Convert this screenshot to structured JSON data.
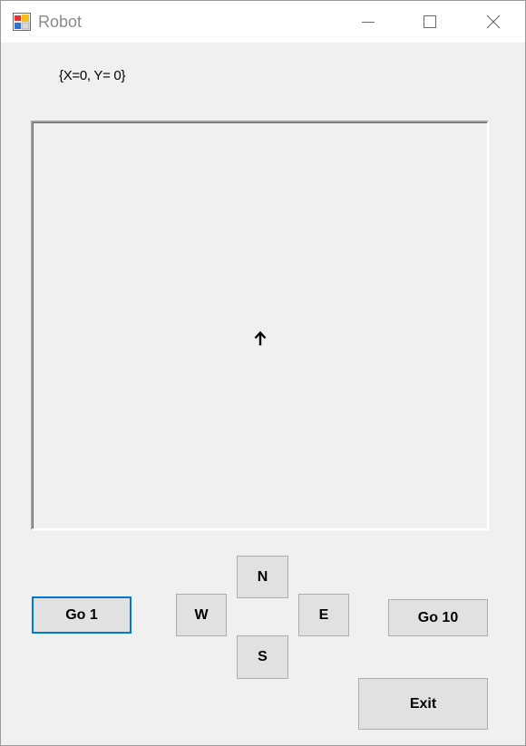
{
  "window": {
    "title": "Robot",
    "controls": {
      "minimize": "minimize-icon",
      "maximize": "maximize-icon",
      "close": "close-icon"
    }
  },
  "status": {
    "coordinates": "{X=0, Y= 0}"
  },
  "canvas": {
    "robot_icon": "arrow-up-icon",
    "robot_direction": "N"
  },
  "buttons": {
    "go1": "Go 1",
    "north": "N",
    "west": "W",
    "east": "E",
    "south": "S",
    "go10": "Go 10",
    "exit": "Exit"
  },
  "colors": {
    "window_bg": "#f0f0f0",
    "focus_border": "#0078d7",
    "button_bg": "#e1e1e1"
  }
}
